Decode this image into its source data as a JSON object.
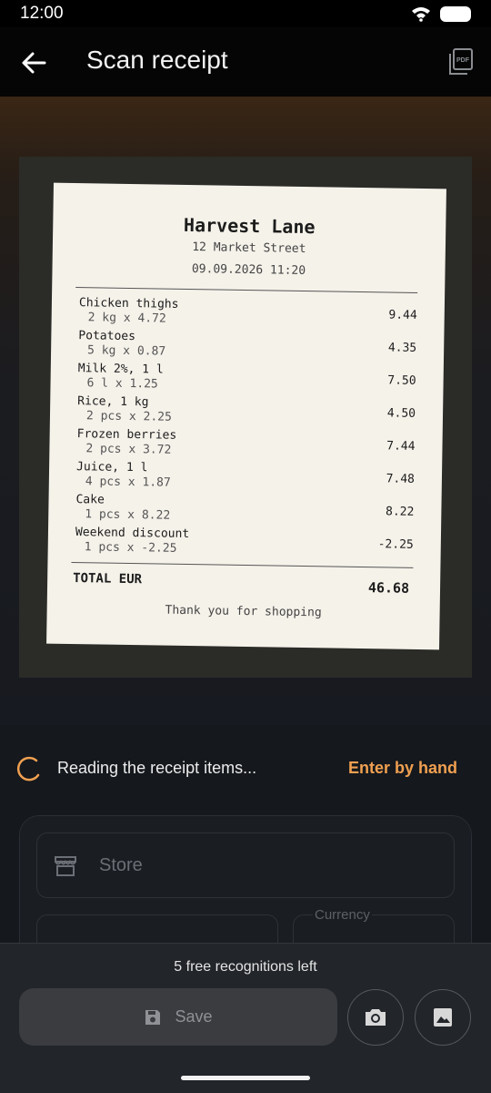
{
  "status": {
    "time": "12:00"
  },
  "appbar": {
    "title": "Scan receipt",
    "back_icon": "arrow-left-icon",
    "pdf_icon": "pdf-icon"
  },
  "receipt": {
    "store": "Harvest Lane",
    "address": "12 Market Street",
    "datetime": "09.09.2026  11:20",
    "items": [
      {
        "name": "Chicken thighs",
        "qty": "2 kg x 4.72",
        "price": "9.44"
      },
      {
        "name": "Potatoes",
        "qty": "5 kg x 0.87",
        "price": "4.35"
      },
      {
        "name": "Milk 2%, 1 l",
        "qty": "6 l x 1.25",
        "price": "7.50"
      },
      {
        "name": "Rice, 1 kg",
        "qty": "2 pcs x 2.25",
        "price": "4.50"
      },
      {
        "name": "Frozen berries",
        "qty": "2 pcs x 3.72",
        "price": "7.44"
      },
      {
        "name": "Juice, 1 l",
        "qty": "4 pcs x 1.87",
        "price": "7.48"
      },
      {
        "name": "Cake",
        "qty": "1 pcs x 8.22",
        "price": "8.22"
      },
      {
        "name": "Weekend discount",
        "qty": "1 pcs x -2.25",
        "price": "-2.25"
      }
    ],
    "total_label": "TOTAL EUR",
    "total_value": "46.68",
    "thanks": "Thank you for shopping"
  },
  "progress": {
    "text": "Reading the receipt items...",
    "action": "Enter by hand"
  },
  "form": {
    "store_placeholder": "Store",
    "currency_label": "Currency"
  },
  "bottom": {
    "free_left": "5 free recognitions left",
    "save_label": "Save",
    "camera_icon": "camera-icon",
    "gallery_icon": "image-icon"
  },
  "colors": {
    "accent": "#f0a050",
    "background": "#15181d"
  }
}
